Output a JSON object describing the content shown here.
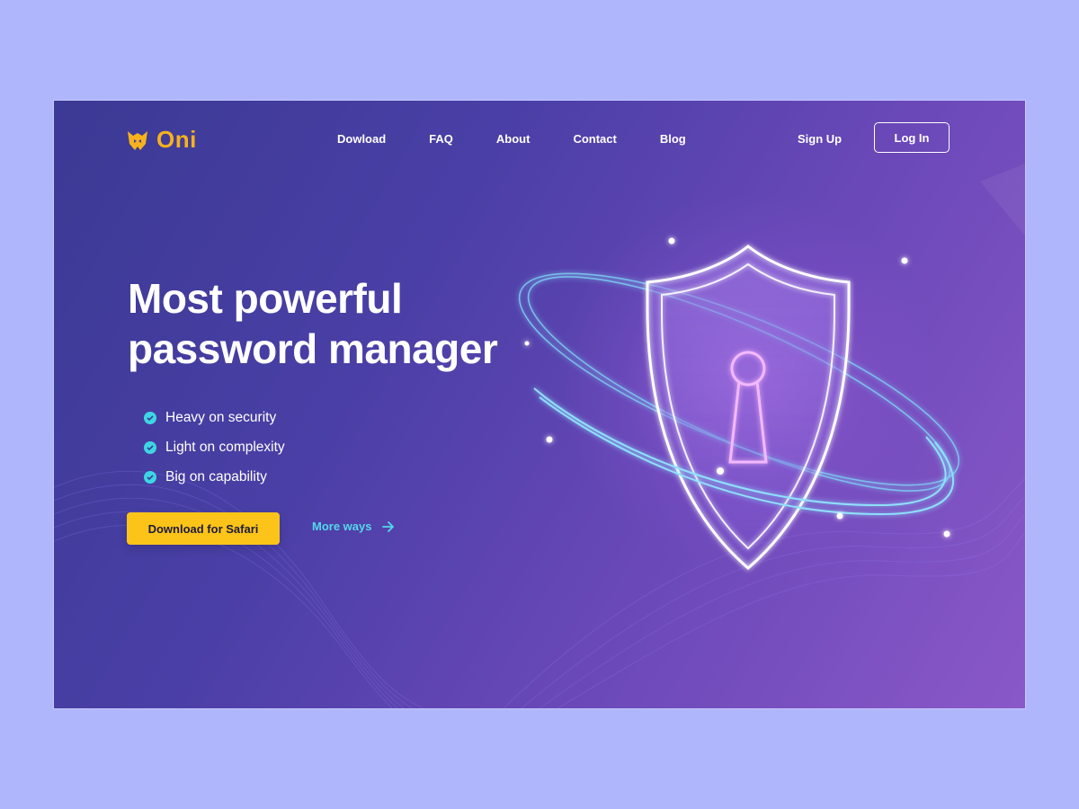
{
  "brand": {
    "name": "Oni",
    "logo_icon": "oni-mask-icon",
    "color": "#f6b21c"
  },
  "nav": {
    "links": [
      {
        "label": "Dowload"
      },
      {
        "label": "FAQ"
      },
      {
        "label": "About"
      },
      {
        "label": "Contact"
      },
      {
        "label": "Blog"
      }
    ],
    "sign_up": "Sign Up",
    "log_in": "Log In"
  },
  "hero": {
    "title_line1": "Most powerful",
    "title_line2": "password manager",
    "features": [
      {
        "label": "Heavy on security",
        "icon": "check-circle-icon"
      },
      {
        "label": "Light on complexity",
        "icon": "check-circle-icon"
      },
      {
        "label": "Big on capability",
        "icon": "check-circle-icon"
      }
    ],
    "cta_label": "Download for Safari",
    "secondary_label": "More ways",
    "secondary_icon": "arrow-right-icon",
    "illustration_icon": "shield-keyhole-icon"
  },
  "colors": {
    "accent_yellow": "#fcc419",
    "accent_cyan": "#55d7ea",
    "check_cyan": "#3ed6e3",
    "page_bg": "#b0b6fb"
  }
}
